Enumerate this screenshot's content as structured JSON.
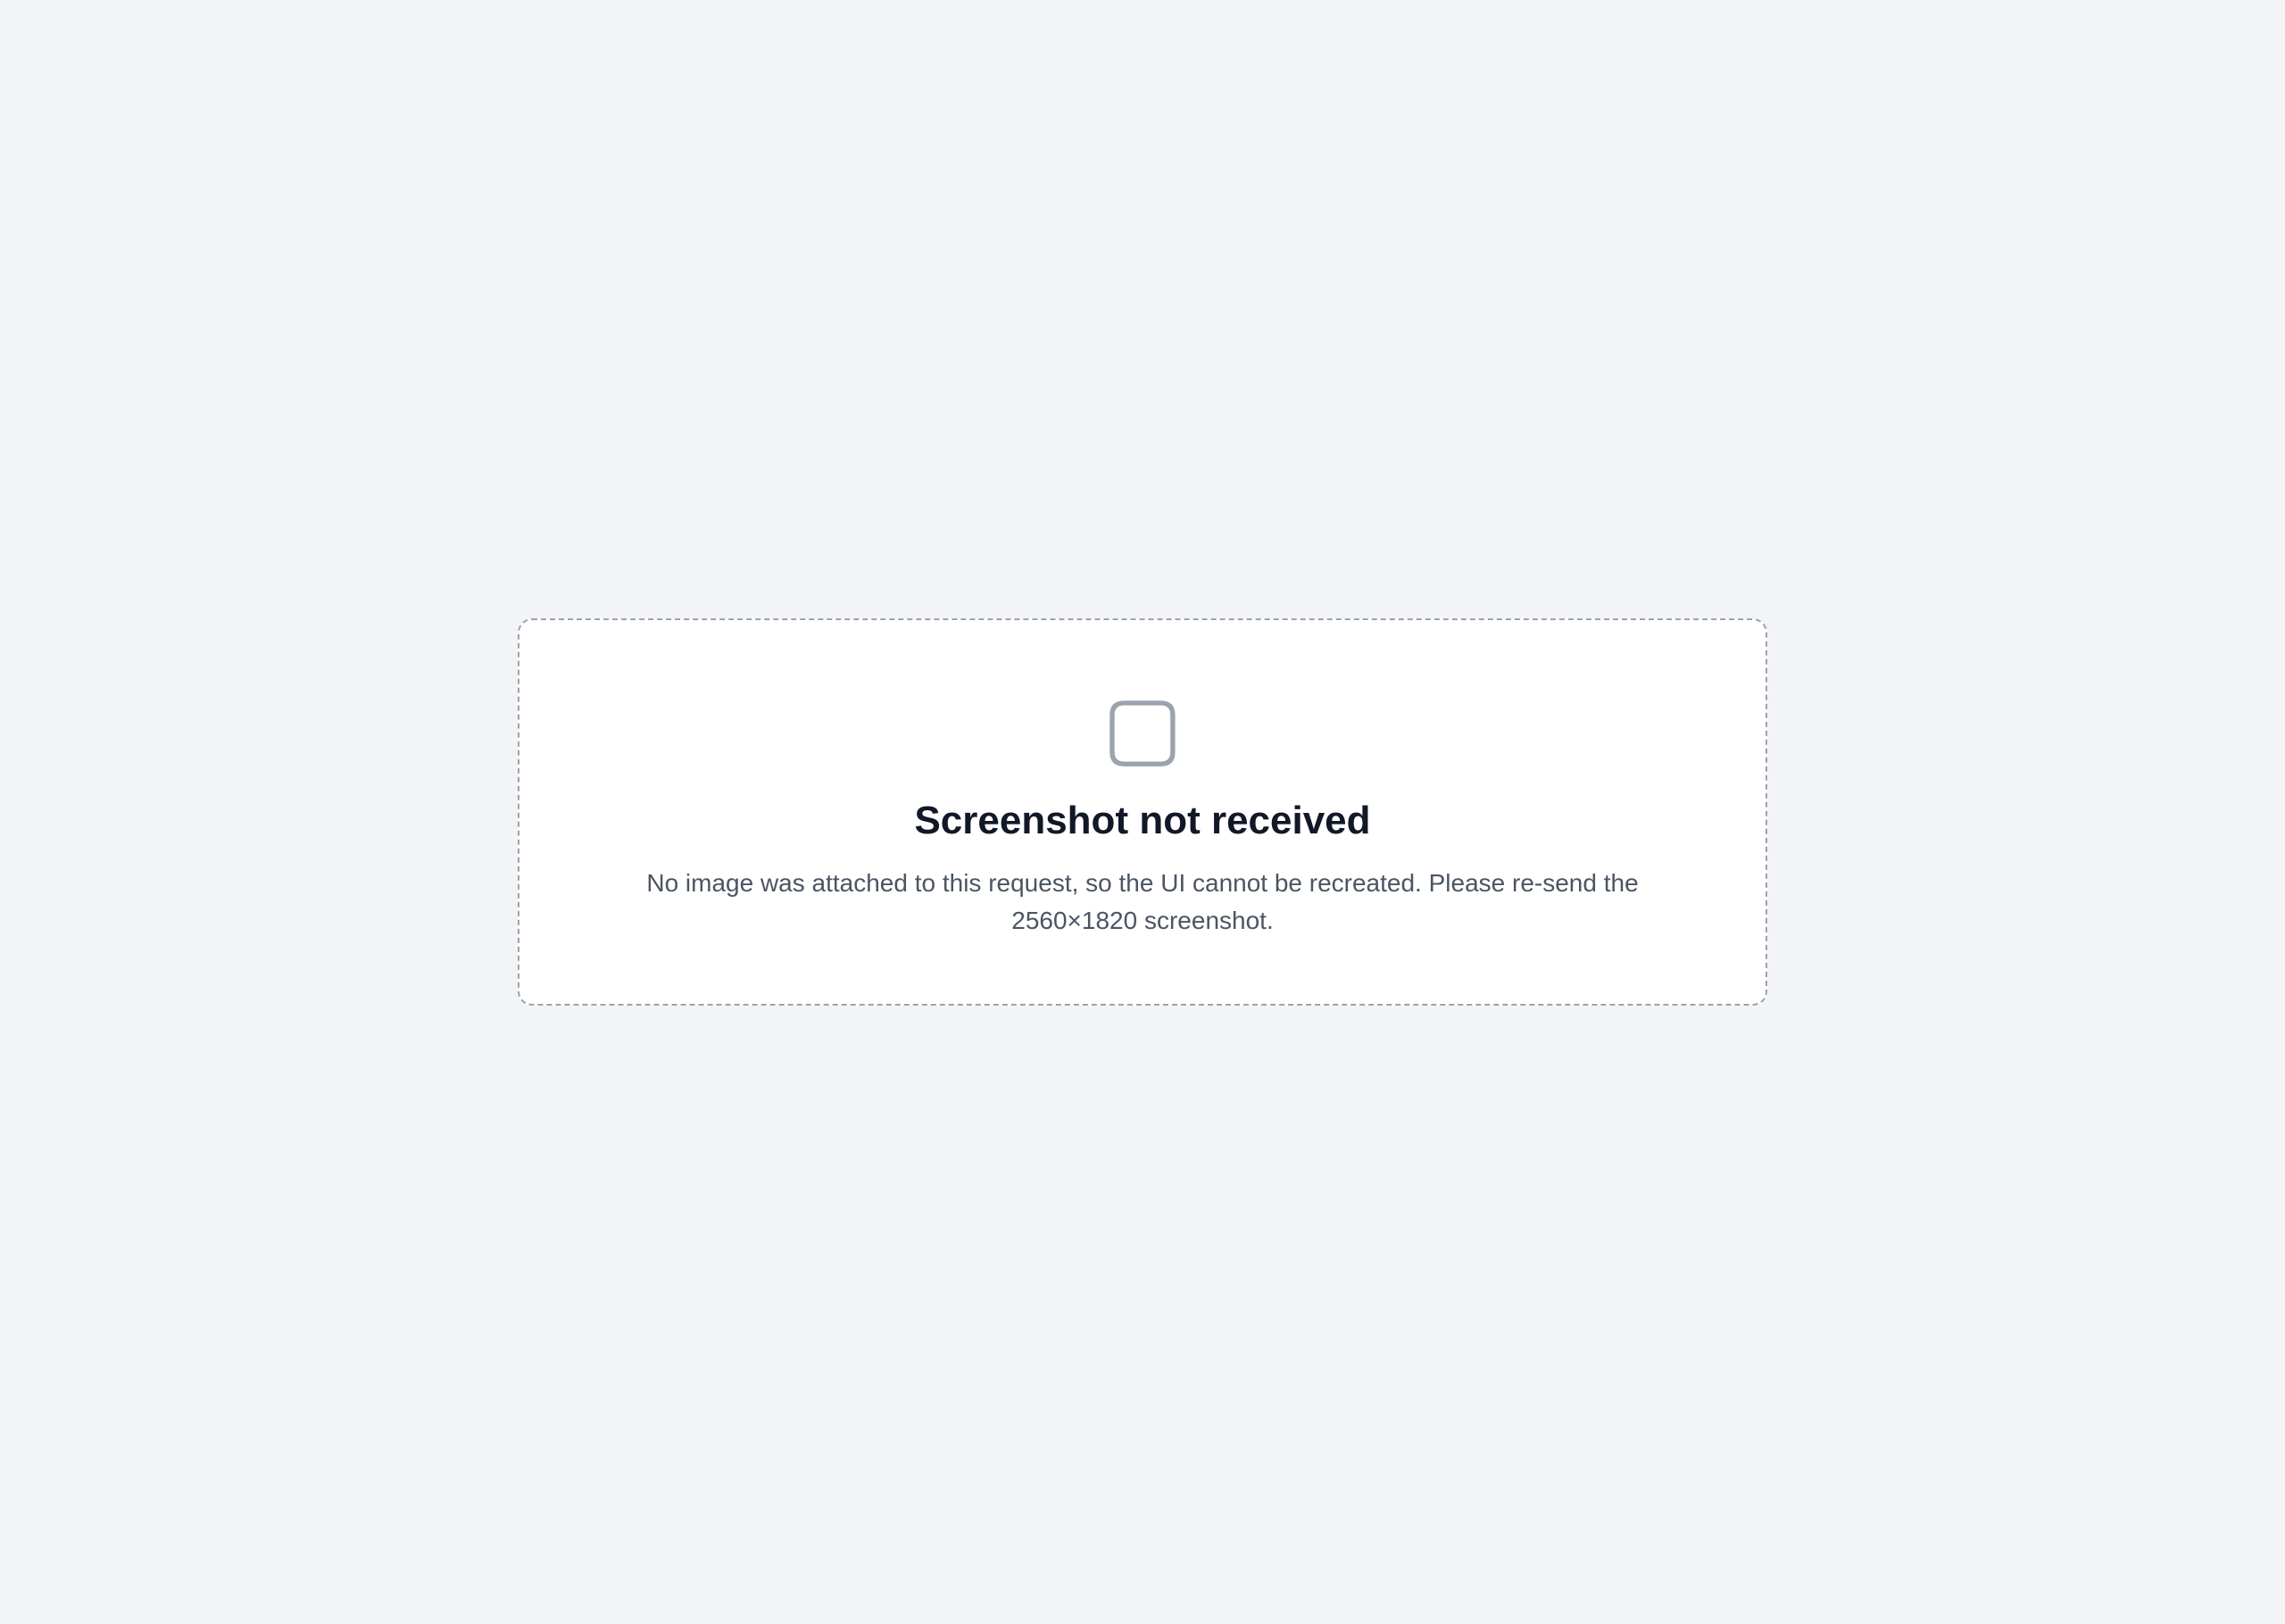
{
  "notice": {
    "title": "Screenshot not received",
    "body": "No image was attached to this request, so the UI cannot be recreated. Please re-send the 2560×1820 screenshot."
  }
}
